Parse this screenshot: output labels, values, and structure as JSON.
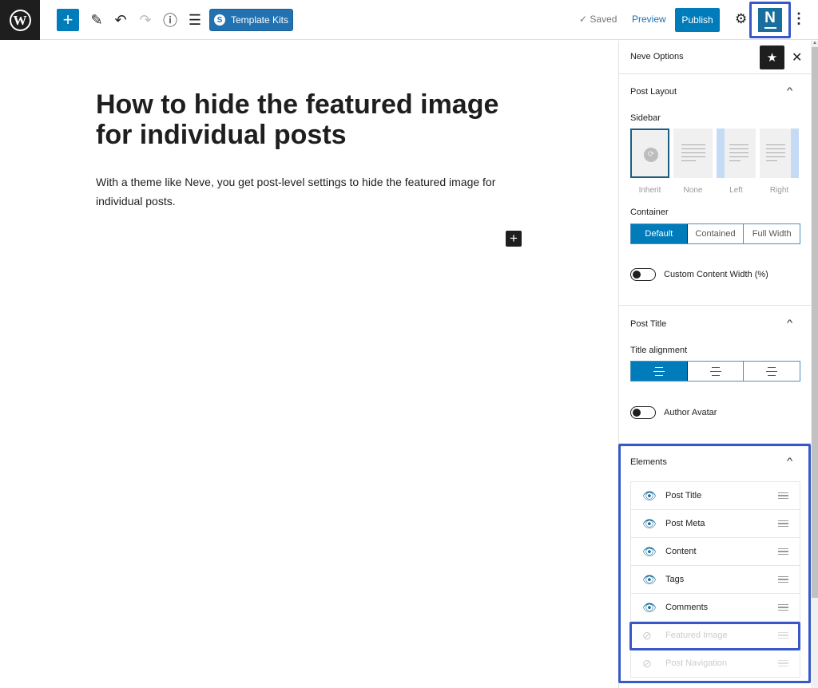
{
  "topbar": {
    "logo_letter": "W",
    "add_label": "+",
    "icons": {
      "tools": "✎",
      "undo": "↶",
      "redo": "↷",
      "info": "ⓘ",
      "list_view": "☰"
    },
    "template_kits_label": "Template Kits",
    "template_kits_icon": "S",
    "saved_label": "✓ Saved",
    "preview_label": "Preview",
    "publish_label": "Publish",
    "settings_icon": "⚙",
    "neve_letter": "N",
    "more_icon": "⋮"
  },
  "editor": {
    "title": "How to hide the featured image for individual posts",
    "body": "With a theme like Neve, you get post-level settings to hide the featured image for individual posts.",
    "inserter_label": "+"
  },
  "sidebar": {
    "title": "Neve Options",
    "star_icon": "★",
    "close_icon": "✕",
    "post_layout": {
      "title": "Post Layout",
      "sidebar_label": "Sidebar",
      "sidebar_options": [
        "Inherit",
        "None",
        "Left",
        "Right"
      ],
      "sidebar_selected": "Inherit",
      "container_label": "Container",
      "container_options": [
        "Default",
        "Contained",
        "Full Width"
      ],
      "container_selected": "Default",
      "custom_width_label": "Custom Content Width (%)",
      "custom_width_enabled": false
    },
    "post_title": {
      "title": "Post Title",
      "alignment_label": "Title alignment",
      "alignment_options": [
        "left",
        "center",
        "right"
      ],
      "alignment_selected": "left",
      "author_avatar_label": "Author Avatar",
      "author_avatar_enabled": false
    },
    "elements": {
      "title": "Elements",
      "items": [
        {
          "label": "Post Title",
          "visible": true
        },
        {
          "label": "Post Meta",
          "visible": true
        },
        {
          "label": "Content",
          "visible": true
        },
        {
          "label": "Tags",
          "visible": true
        },
        {
          "label": "Comments",
          "visible": true
        },
        {
          "label": "Featured Image",
          "visible": false
        },
        {
          "label": "Post Navigation",
          "visible": false
        }
      ]
    },
    "chevron_icon": "^"
  },
  "colors": {
    "accent": "#007cba",
    "highlight": "#3858c8",
    "dark": "#1e1e1e"
  }
}
